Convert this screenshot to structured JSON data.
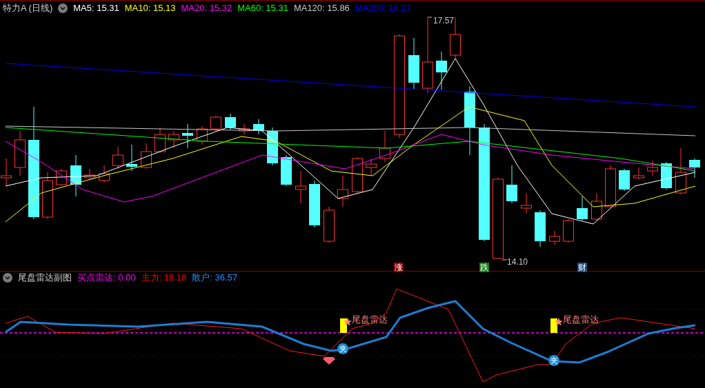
{
  "main_chart": {
    "title": "特力A (日线)",
    "indicators": [
      {
        "label": "MA5: 15.31",
        "color": "#ffffff"
      },
      {
        "label": "MA10: 15.13",
        "color": "#ffff00"
      },
      {
        "label": "MA20: 15.32",
        "color": "#ff00ff"
      },
      {
        "label": "MA60: 15.31",
        "color": "#00ff00"
      },
      {
        "label": "MA120: 15.86",
        "color": "#c8c8c8"
      },
      {
        "label": "MA250: 16.27",
        "color": "#0000ff"
      }
    ],
    "price_labels": [
      {
        "kind": "high",
        "text": "17.57"
      },
      {
        "kind": "low",
        "text": "14.10"
      }
    ],
    "event_markers": [
      {
        "text": "涨",
        "color": "#8b0000"
      },
      {
        "text": "跌",
        "color": "#1a7a1a"
      },
      {
        "text": "财",
        "color": "#1e4b7a"
      }
    ]
  },
  "sub_chart": {
    "title": "尾盘雷达副图",
    "readings": [
      {
        "text": "买点雷达: 0.00",
        "color": "#ff00ff"
      },
      {
        "text": "主力: 18.18",
        "color": "#ff0000"
      },
      {
        "text": "散户: 36.57",
        "color": "#1e90ff"
      }
    ],
    "signals": [
      {
        "text": "尾盘雷达"
      },
      {
        "text": "尾盘雷达"
      }
    ],
    "clamp_marks": [
      {
        "text": "夹"
      },
      {
        "text": "夹"
      }
    ]
  }
}
